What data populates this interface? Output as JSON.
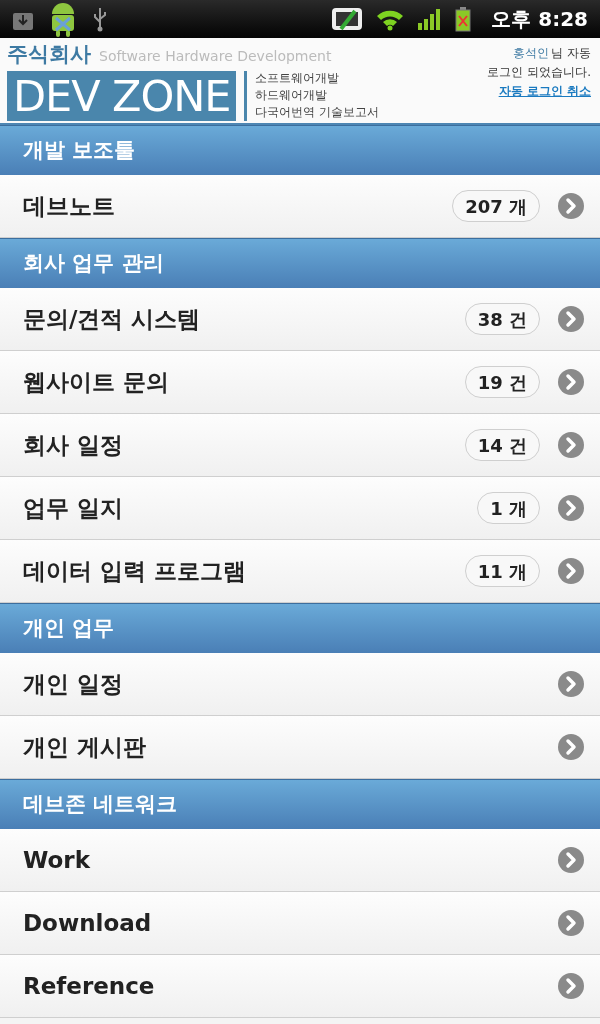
{
  "status_bar": {
    "time": "오후 8:28"
  },
  "header": {
    "company": "주식회사",
    "tagline": "Software Hardware Development",
    "logo": "DEV ZONE",
    "services": [
      "소프트웨어개발",
      "하드웨어개발",
      "다국어번역 기술보고서"
    ],
    "user_name": "홍석인",
    "login_suffix": "님 자동",
    "login_message": "로그인 되었습니다.",
    "logout_link": "자동 로그인 취소"
  },
  "sections": [
    {
      "title": "개발 보조툴",
      "items": [
        {
          "label": "데브노트",
          "count": "207 개"
        }
      ]
    },
    {
      "title": "회사 업무 관리",
      "items": [
        {
          "label": "문의/견적 시스템",
          "count": "38 건"
        },
        {
          "label": "웹사이트 문의",
          "count": "19 건"
        },
        {
          "label": "회사 일정",
          "count": "14 건"
        },
        {
          "label": "업무 일지",
          "count": "1 개"
        },
        {
          "label": "데이터 입력 프로그램",
          "count": "11 개"
        }
      ]
    },
    {
      "title": "개인 업무",
      "items": [
        {
          "label": "개인 일정"
        },
        {
          "label": "개인 게시판"
        }
      ]
    },
    {
      "title": "데브존 네트워크",
      "items": [
        {
          "label": "Work"
        },
        {
          "label": "Download"
        },
        {
          "label": "Reference"
        }
      ]
    }
  ]
}
